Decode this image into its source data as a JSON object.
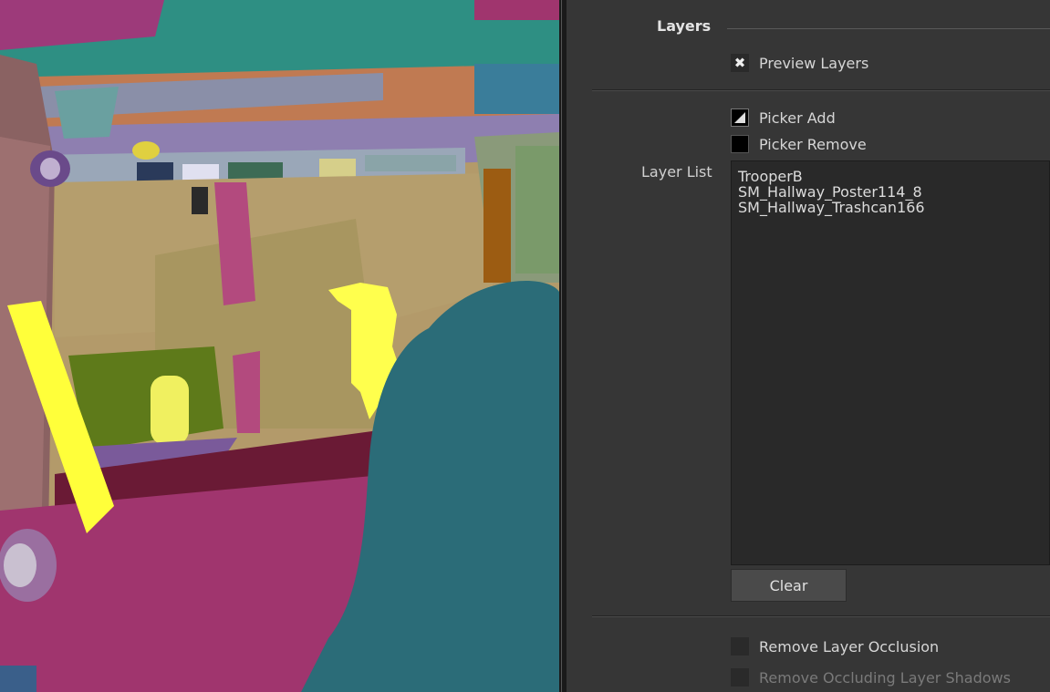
{
  "panel": {
    "section_title": "Layers",
    "preview_layers": {
      "label": "Preview Layers",
      "checked": true,
      "check_glyph": "✖"
    },
    "picker_add": {
      "label": "Picker Add",
      "icon": "picker-add-icon"
    },
    "picker_remove": {
      "label": "Picker Remove",
      "icon": "picker-remove-icon"
    },
    "layer_list_label": "Layer List",
    "layer_list": [
      {
        "name": "TrooperB"
      },
      {
        "name": "SM_Hallway_Poster114_8"
      },
      {
        "name": "SM_Hallway_Trashcan166"
      }
    ],
    "clear_button": "Clear",
    "remove_layer_occlusion": {
      "label": "Remove Layer Occlusion",
      "checked": false
    },
    "remove_occluding_shadows": {
      "label": "Remove Occluding Layer Shadows",
      "checked": false,
      "enabled": false
    }
  },
  "colors": {
    "panel_bg": "#363636",
    "highlight_yellow": "#ffff4d",
    "teal": "#2b6c78",
    "magenta": "#a0356e"
  }
}
